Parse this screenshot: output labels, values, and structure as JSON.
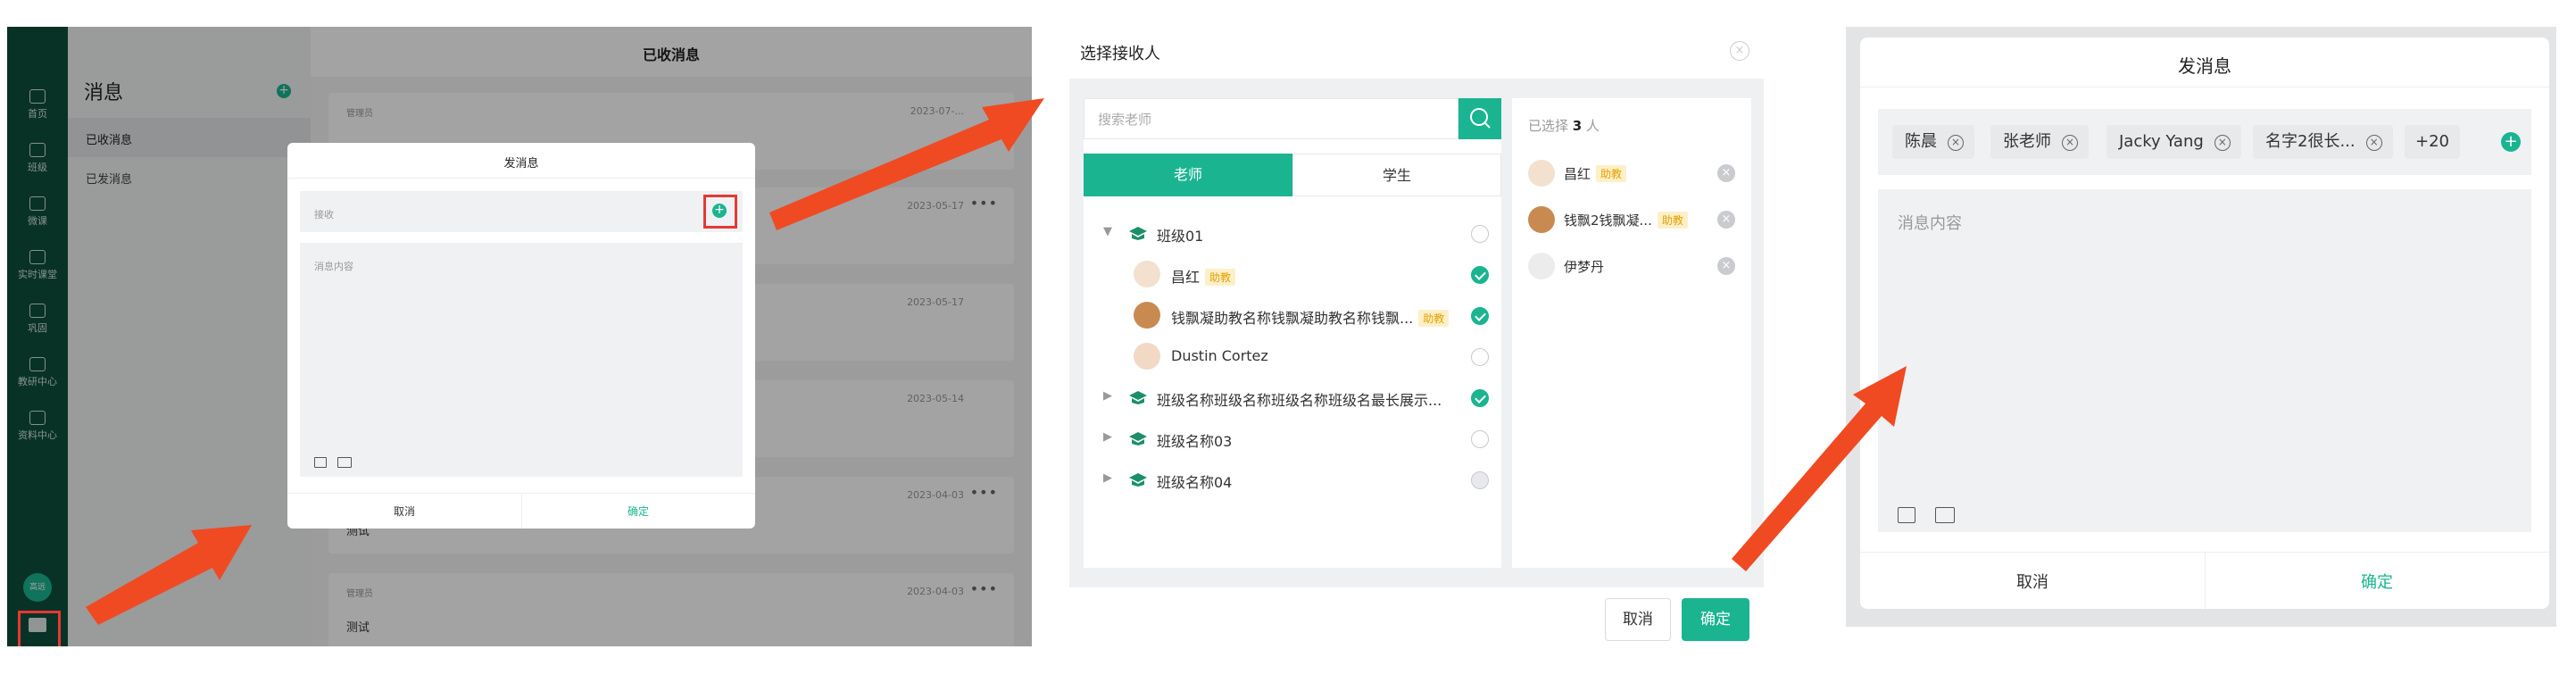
{
  "panel1": {
    "nav": [
      {
        "label": "首页",
        "icon": "home-icon"
      },
      {
        "label": "班级",
        "icon": "users-icon"
      },
      {
        "label": "微课",
        "icon": "video-icon"
      },
      {
        "label": "实时课堂",
        "icon": "live-icon"
      },
      {
        "label": "巩固",
        "icon": "document-icon"
      },
      {
        "label": "教研中心",
        "icon": "book-icon"
      },
      {
        "label": "资料中心",
        "icon": "database-icon"
      }
    ],
    "user_badge": "高远",
    "list_title": "消息",
    "list_items": [
      "已收消息",
      "已发消息"
    ],
    "main_title": "已收消息",
    "cards": [
      {
        "meta": "管理员",
        "date": "2023-07-...",
        "text": ""
      },
      {
        "meta": "",
        "date": "2023-05-17",
        "text": ""
      },
      {
        "meta": "",
        "date": "2023-05-17",
        "text": ""
      },
      {
        "meta": "",
        "date": "2023-05-14",
        "text": ""
      },
      {
        "meta": "",
        "date": "2023-04-03",
        "text": "测试"
      },
      {
        "meta": "管理员",
        "date": "2023-04-03",
        "text": "测试"
      }
    ],
    "modal": {
      "title": "发消息",
      "recipient_placeholder": "接收",
      "content_placeholder": "消息内容",
      "cancel": "取消",
      "confirm": "确定"
    }
  },
  "panel2": {
    "title": "选择接收人",
    "search_placeholder": "搜索老师",
    "tabs": [
      "老师",
      "学生"
    ],
    "active_tab": 0,
    "tree": [
      {
        "label": "班级01",
        "expanded": true,
        "checked": false,
        "level": 0
      },
      {
        "label": "昌红",
        "tag": "助教",
        "checked": true,
        "level": 1
      },
      {
        "label": "钱飘凝助教名称钱飘凝助教名称钱飘...",
        "tag": "助教",
        "checked": true,
        "level": 1
      },
      {
        "label": "Dustin Cortez",
        "checked": false,
        "level": 1
      },
      {
        "label": "班级名称班级名称班级名称班级名最长展示...",
        "expanded": false,
        "checked": true,
        "level": 0
      },
      {
        "label": "班级名称03",
        "expanded": false,
        "checked": false,
        "level": 0
      },
      {
        "label": "班级名称04",
        "expanded": false,
        "checked": false,
        "disabled": true,
        "level": 0
      }
    ],
    "selected_prefix": "已选择",
    "selected_count": "3",
    "selected_suffix": "人",
    "selected": [
      {
        "name": "昌红",
        "tag": "助教"
      },
      {
        "name": "钱飘2钱飘凝...",
        "tag": "助教"
      },
      {
        "name": "伊梦丹",
        "tag": ""
      }
    ],
    "cancel": "取消",
    "confirm": "确定"
  },
  "panel3": {
    "title": "发消息",
    "chips": [
      "陈晨",
      "张老师",
      "Jacky Yang",
      "名字2很长..."
    ],
    "more_count": "+20",
    "content_placeholder": "消息内容",
    "cancel": "取消",
    "confirm": "确定"
  },
  "colors": {
    "brand_green": "#1ab491",
    "sidebar": "#0f4f3c",
    "arrow_red": "#f04a22",
    "highlight_red": "#e53935"
  }
}
